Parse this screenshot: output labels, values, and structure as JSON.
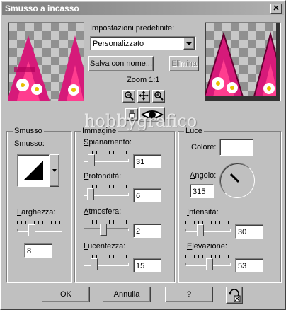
{
  "window": {
    "title": "Smusso a incasso",
    "close_glyph": "✕"
  },
  "presets": {
    "label": "Impostazioni predefinite:",
    "selected": "Personalizzato",
    "save_label": "Salva con nome...",
    "delete_label": "Elimina"
  },
  "zoom": {
    "label": "Zoom 1:1"
  },
  "watermark": "hobbygrafico",
  "groups": {
    "smusso": {
      "title": "Smusso",
      "smusso_label": "Smusso:",
      "larghezza_label": "Larghezza:",
      "larghezza_value": "8",
      "larghezza_level": 0.3
    },
    "immagine": {
      "title": "Immagine",
      "spianamento_label": "Spianamento:",
      "spianamento_value": "31",
      "spianamento_level": 0.12,
      "profondita_label": "Profondità:",
      "profondita_value": "6",
      "profondita_level": 0.1,
      "atmosfera_label": "Atmosfera:",
      "atmosfera_value": "2",
      "atmosfera_level": 0.45,
      "lucentezza_label": "Lucentezza:",
      "lucentezza_value": "15",
      "lucentezza_level": 0.2
    },
    "luce": {
      "title": "Luce",
      "colore_label": "Colore:",
      "angolo_label": "Angolo:",
      "angolo_value": "315",
      "intensita_label": "Intensità:",
      "intensita_value": "30",
      "intensita_level": 0.3,
      "elevazione_label": "Elevazione:",
      "elevazione_value": "53",
      "elevazione_level": 0.55
    }
  },
  "buttons": {
    "ok": "OK",
    "cancel": "Annulla",
    "help": "?"
  },
  "colors": {
    "light_color": "#ffffff",
    "dialog_bg": "#c0c0c0"
  }
}
